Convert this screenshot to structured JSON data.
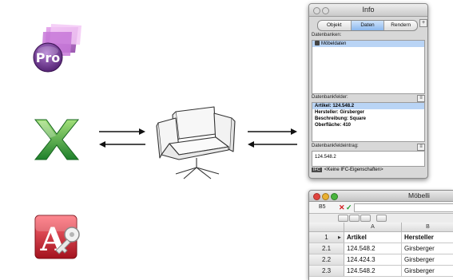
{
  "info_palette": {
    "title": "Info",
    "tabs": [
      {
        "label": "Objekt",
        "active": false
      },
      {
        "label": "Daten",
        "active": true
      },
      {
        "label": "Rendern",
        "active": false
      }
    ],
    "databases_label": "Datenbanken:",
    "databases": [
      "Möbeldaten"
    ],
    "fields_label": "Datenbankfelder:",
    "fields": [
      "Artikel: 124.548.2",
      "Hersteller: Girsberger",
      "Beschreibung: Square",
      "Oberfläche: 410"
    ],
    "entry_label": "Datenbankfeldeintrag:",
    "entry_value": "124.548.2",
    "ifc_badge": "IFC",
    "ifc_text": "<Keine IFC-Eigenschaften>"
  },
  "spreadsheet": {
    "title": "Möbelli",
    "cell_ref": "B5",
    "columns": [
      "A",
      "B"
    ],
    "rows": [
      {
        "num": "1",
        "a": "Artikel",
        "b": "Hersteller",
        "header": true
      },
      {
        "num": "2.1",
        "a": "124.548.2",
        "b": "Girsberger",
        "header": false
      },
      {
        "num": "2.2",
        "a": "124.424.3",
        "b": "Girsberger",
        "header": false
      },
      {
        "num": "2.3",
        "a": "124.548.2",
        "b": "Girsberger",
        "header": false
      }
    ]
  },
  "apps": {
    "top": {
      "name": "filemaker-pro-icon",
      "text": "Pro"
    },
    "middle": {
      "name": "excel-icon"
    },
    "bottom": {
      "name": "access-icon",
      "text": "A"
    }
  },
  "colors": {
    "pro_purple": "#6f2f8f",
    "excel_green": "#2e9a3a",
    "access_red": "#c6202c",
    "selection_blue": "#b9d4f5"
  }
}
